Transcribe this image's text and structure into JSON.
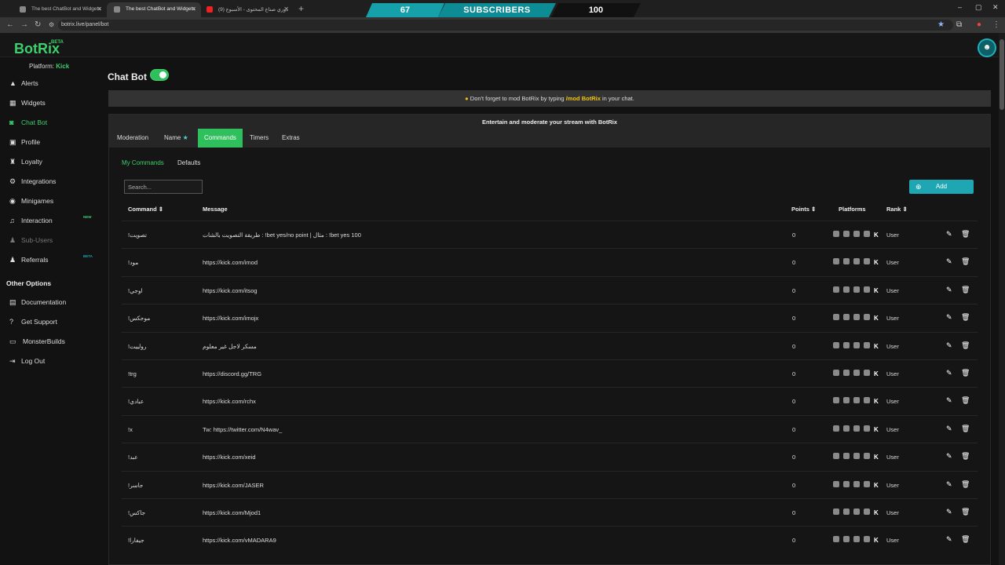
{
  "browser": {
    "tabs": [
      {
        "title": "The best ChatBot and Widgets",
        "icon": "botrix-favicon"
      },
      {
        "title": "The best ChatBot and Widgets",
        "icon": "botrix-favicon"
      },
      {
        "title": "(9) دوري صناع المحتوى - الأسبوع",
        "icon": "youtube-favicon"
      }
    ],
    "url": "botrix.live/panel/bot"
  },
  "overlay": {
    "left_count": "67",
    "label": "SUBSCRIBERS",
    "right_count": "100"
  },
  "app": {
    "logo": "BotRix",
    "beta": "BETA",
    "platform_label": "Platform:",
    "platform_value": "Kick"
  },
  "sidebar": {
    "items": [
      {
        "label": "Alerts",
        "icon": "alert-icon"
      },
      {
        "label": "Widgets",
        "icon": "widgets-icon"
      },
      {
        "label": "Chat Bot",
        "icon": "robot-icon"
      },
      {
        "label": "Profile",
        "icon": "profile-icon"
      },
      {
        "label": "Loyalty",
        "icon": "trophy-icon"
      },
      {
        "label": "Integrations",
        "icon": "integrations-icon"
      },
      {
        "label": "Minigames",
        "icon": "gamepad-icon"
      },
      {
        "label": "Interaction",
        "icon": "music-icon",
        "tag": "NEW"
      },
      {
        "label": "Sub-Users",
        "icon": "users-icon"
      },
      {
        "label": "Referrals",
        "icon": "referrals-icon",
        "tag": "BETA"
      }
    ],
    "other_heading": "Other Options",
    "other_items": [
      {
        "label": "Documentation",
        "icon": "document-icon"
      },
      {
        "label": "Get Support",
        "icon": "support-icon"
      },
      {
        "label": "MonsterBuilds",
        "icon": "monitor-icon"
      },
      {
        "label": "Log Out",
        "icon": "logout-icon"
      }
    ]
  },
  "main": {
    "title": "Chat Bot",
    "notice_pre": "Don't forget to mod BotRix by typing",
    "notice_cmd": "/mod BotRix",
    "notice_post": "in your chat.",
    "panel_title": "Entertain and moderate your stream with BotRix",
    "tabs": [
      "Moderation",
      "Name",
      "Commands",
      "Timers",
      "Extras"
    ],
    "subtabs": [
      "My Commands",
      "Defaults"
    ],
    "search_placeholder": "Search...",
    "add_label": "Add",
    "columns": {
      "command": "Command",
      "message": "Message",
      "points": "Points",
      "platforms": "Platforms",
      "rank": "Rank"
    },
    "rows": [
      {
        "command": "!تصويت",
        "message": "طريقة التصويت بالشات : !bet yes/no point | مثال : !bet yes 100",
        "points": "0",
        "rank": "User"
      },
      {
        "command": "!مود",
        "message": "https://kick.com/imod",
        "points": "0",
        "rank": "User"
      },
      {
        "command": "!اوجي",
        "message": "https://kick.com/itsog",
        "points": "0",
        "rank": "User"
      },
      {
        "command": "!موجكس",
        "message": "https://kick.com/imojx",
        "points": "0",
        "rank": "User"
      },
      {
        "command": "!رولييت",
        "message": "مسكر لاجل غير معلوم",
        "points": "0",
        "rank": "User"
      },
      {
        "command": "!trg",
        "message": "https://discord.gg/TRG",
        "points": "0",
        "rank": "User"
      },
      {
        "command": "!عبادي",
        "message": "https://kick.com/rchx",
        "points": "0",
        "rank": "User"
      },
      {
        "command": "!x",
        "message": "Tw: https://twitter.com/N4wav_",
        "points": "0",
        "rank": "User"
      },
      {
        "command": "!عبد",
        "message": "https://kick.com/xeid",
        "points": "0",
        "rank": "User"
      },
      {
        "command": "!جاسر",
        "message": "https://kick.com/JASER",
        "points": "0",
        "rank": "User"
      },
      {
        "command": "!جاكس",
        "message": "https://kick.com/Mjod1",
        "points": "0",
        "rank": "User"
      },
      {
        "command": "!جيفارا",
        "message": "https://kick.com/vMADARA9",
        "points": "0",
        "rank": "User"
      }
    ]
  },
  "colors": {
    "accent": "#2fbf5c",
    "teal": "#1ea6b3",
    "background": "#121212"
  }
}
